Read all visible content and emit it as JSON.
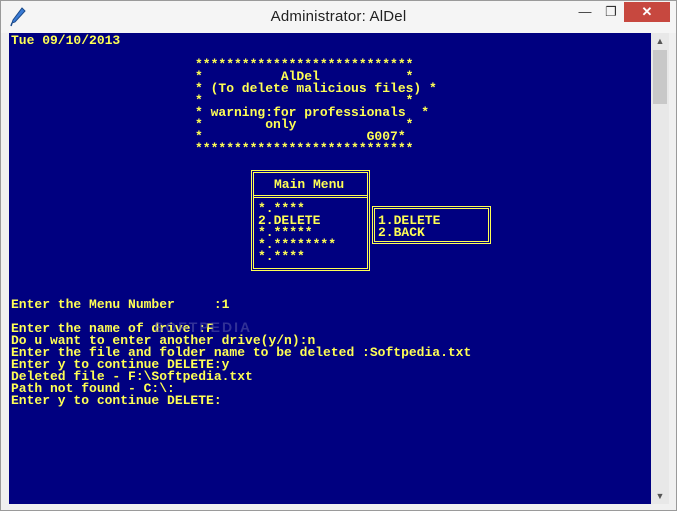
{
  "window": {
    "title": "Administrator:  AlDel",
    "minimize_glyph": "—",
    "maximize_glyph": "❐",
    "close_glyph": "✕",
    "app_icon": "pen-icon"
  },
  "console": {
    "date_line": "Tue 09/10/2013",
    "banner": [
      "****************************",
      "*          AlDel           *",
      "* (To delete malicious files) *",
      "*                          *",
      "* warning:for professionals  *",
      "*        only              *",
      "*                     G007*",
      "****************************"
    ],
    "menu": {
      "title": "Main Menu",
      "items": [
        "*.****",
        "2.DELETE",
        "*.*****",
        "*.********",
        "*.****"
      ]
    },
    "submenu": {
      "items": [
        "1.DELETE",
        "2.BACK"
      ]
    },
    "output": [
      "Enter the Menu Number     :1",
      "",
      "Enter the name of drive :F",
      "Do u want to enter another drive(y/n):n",
      "Enter the file and folder name to be deleted :Softpedia.txt",
      "Enter y to continue DELETE:y",
      "Deleted file - F:\\Softpedia.txt",
      "Path not found - C:\\:",
      "Enter y to continue DELETE:"
    ],
    "watermark": "SOFTPEDIA"
  },
  "scrollbar": {
    "up_glyph": "▲",
    "down_glyph": "▼"
  },
  "colors": {
    "console_bg": "#000080",
    "console_text": "#ffff54",
    "close_button": "#c7483f"
  }
}
